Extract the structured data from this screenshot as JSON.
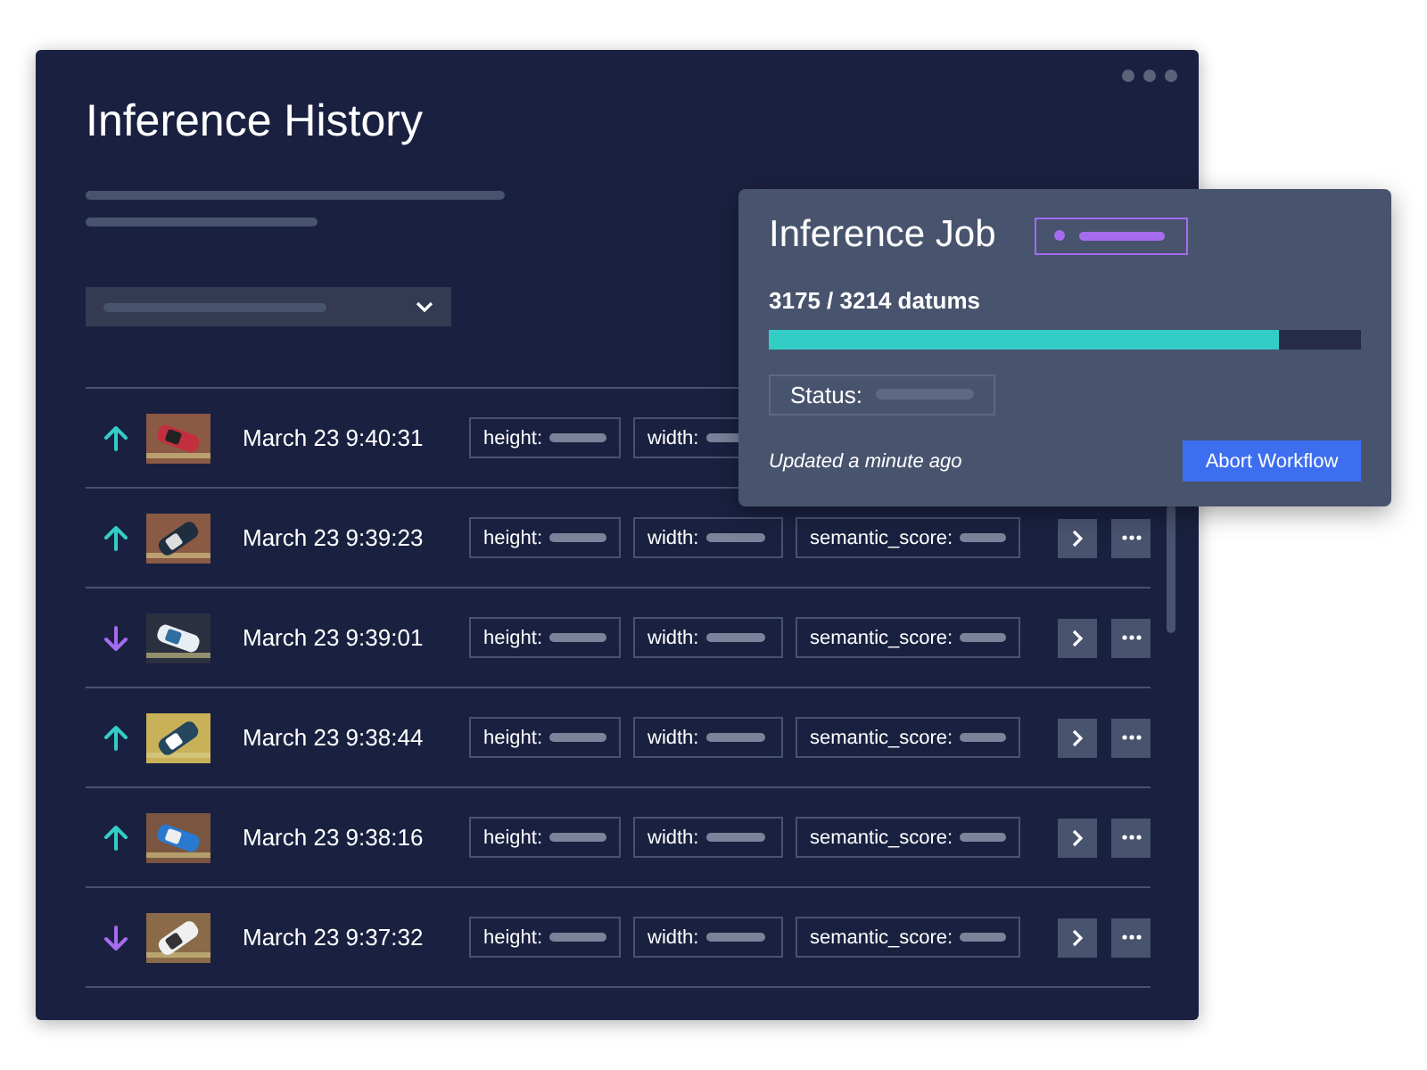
{
  "window": {
    "title": "Inference History"
  },
  "rows": [
    {
      "kind": "up",
      "time": "March 23 9:40:31",
      "fields": [
        "height:",
        "width:"
      ],
      "actions_visible": false
    },
    {
      "kind": "up",
      "time": "March 23 9:39:23",
      "fields": [
        "height:",
        "width:",
        "semantic_score:"
      ],
      "actions_visible": true
    },
    {
      "kind": "down",
      "time": "March 23 9:39:01",
      "fields": [
        "height:",
        "width:",
        "semantic_score:"
      ],
      "actions_visible": true
    },
    {
      "kind": "up",
      "time": "March 23 9:38:44",
      "fields": [
        "height:",
        "width:",
        "semantic_score:"
      ],
      "actions_visible": true
    },
    {
      "kind": "up",
      "time": "March 23 9:38:16",
      "fields": [
        "height:",
        "width:",
        "semantic_score:"
      ],
      "actions_visible": true
    },
    {
      "kind": "down",
      "time": "March 23 9:37:32",
      "fields": [
        "height:",
        "width:",
        "semantic_score:"
      ],
      "actions_visible": true
    }
  ],
  "job": {
    "title": "Inference Job",
    "progress_text": "3175 / 3214 datums",
    "level": 0.86,
    "status_label": "Status:",
    "updated": "Updated a minute ago",
    "button": "Abort Workflow"
  }
}
